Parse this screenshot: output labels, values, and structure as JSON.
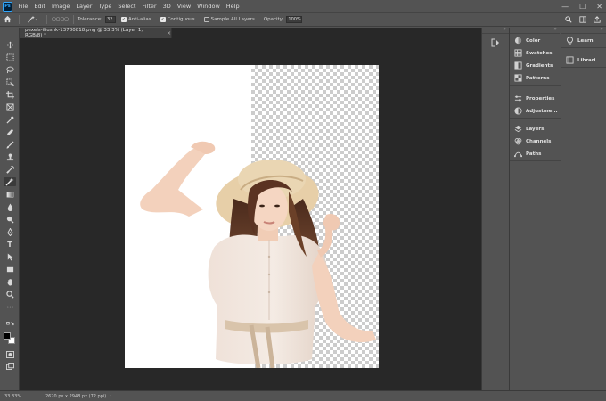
{
  "app": {
    "logo_text": "Ps"
  },
  "menu": [
    "File",
    "Edit",
    "Image",
    "Layer",
    "Type",
    "Select",
    "Filter",
    "3D",
    "View",
    "Window",
    "Help"
  ],
  "window_controls": {
    "minimize": "—",
    "maximize": "☐",
    "close": "✕"
  },
  "options_bar": {
    "tolerance_label": "Tolerance:",
    "tolerance_value": "32",
    "anti_alias_label": "Anti-alias",
    "contiguous_label": "Contiguous",
    "sample_all_layers_label": "Sample All Layers",
    "opacity_label": "Opacity:",
    "opacity_value": "100%"
  },
  "document": {
    "tab_title": "pexels-iliushk-13780818.png @ 33.3% (Layer 1, RGB/8) *",
    "close_glyph": "×"
  },
  "status_bar": {
    "zoom": "33.33%",
    "doc_size": "2620 px x 2948 px (72 ppi)",
    "arrow": "›"
  },
  "panels": {
    "group1": [
      "Color",
      "Swatches",
      "Gradients",
      "Patterns"
    ],
    "group2": [
      "Properties",
      "Adjustme..."
    ],
    "group3": [
      "Layers",
      "Channels",
      "Paths"
    ]
  },
  "learn_panels": [
    "Learn",
    "Librari..."
  ],
  "colors": {
    "ui_bg": "#535353",
    "canvas_bg": "#282828",
    "foreground": "#000000",
    "background": "#ffffff",
    "accent": "#31a8ff"
  }
}
